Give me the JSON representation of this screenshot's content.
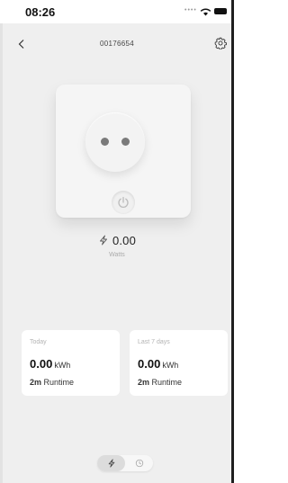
{
  "status_bar": {
    "time": "08:26"
  },
  "header": {
    "title": "00176654"
  },
  "power": {
    "value": "0.00",
    "unit": "Watts"
  },
  "stats": [
    {
      "label": "Today",
      "value": "0.00",
      "unit": "kWh",
      "runtime_value": "2m",
      "runtime_label": "Runtime"
    },
    {
      "label": "Last 7 days",
      "value": "0.00",
      "unit": "kWh",
      "runtime_value": "2m",
      "runtime_label": "Runtime"
    }
  ],
  "icons": {
    "back": "chevron-left-icon",
    "settings": "gear-icon",
    "power_button": "power-icon",
    "bolt": "lightning-icon",
    "history": "clock-icon"
  },
  "colors": {
    "background": "#efefef",
    "card": "#ffffff",
    "accent": "#222222"
  }
}
